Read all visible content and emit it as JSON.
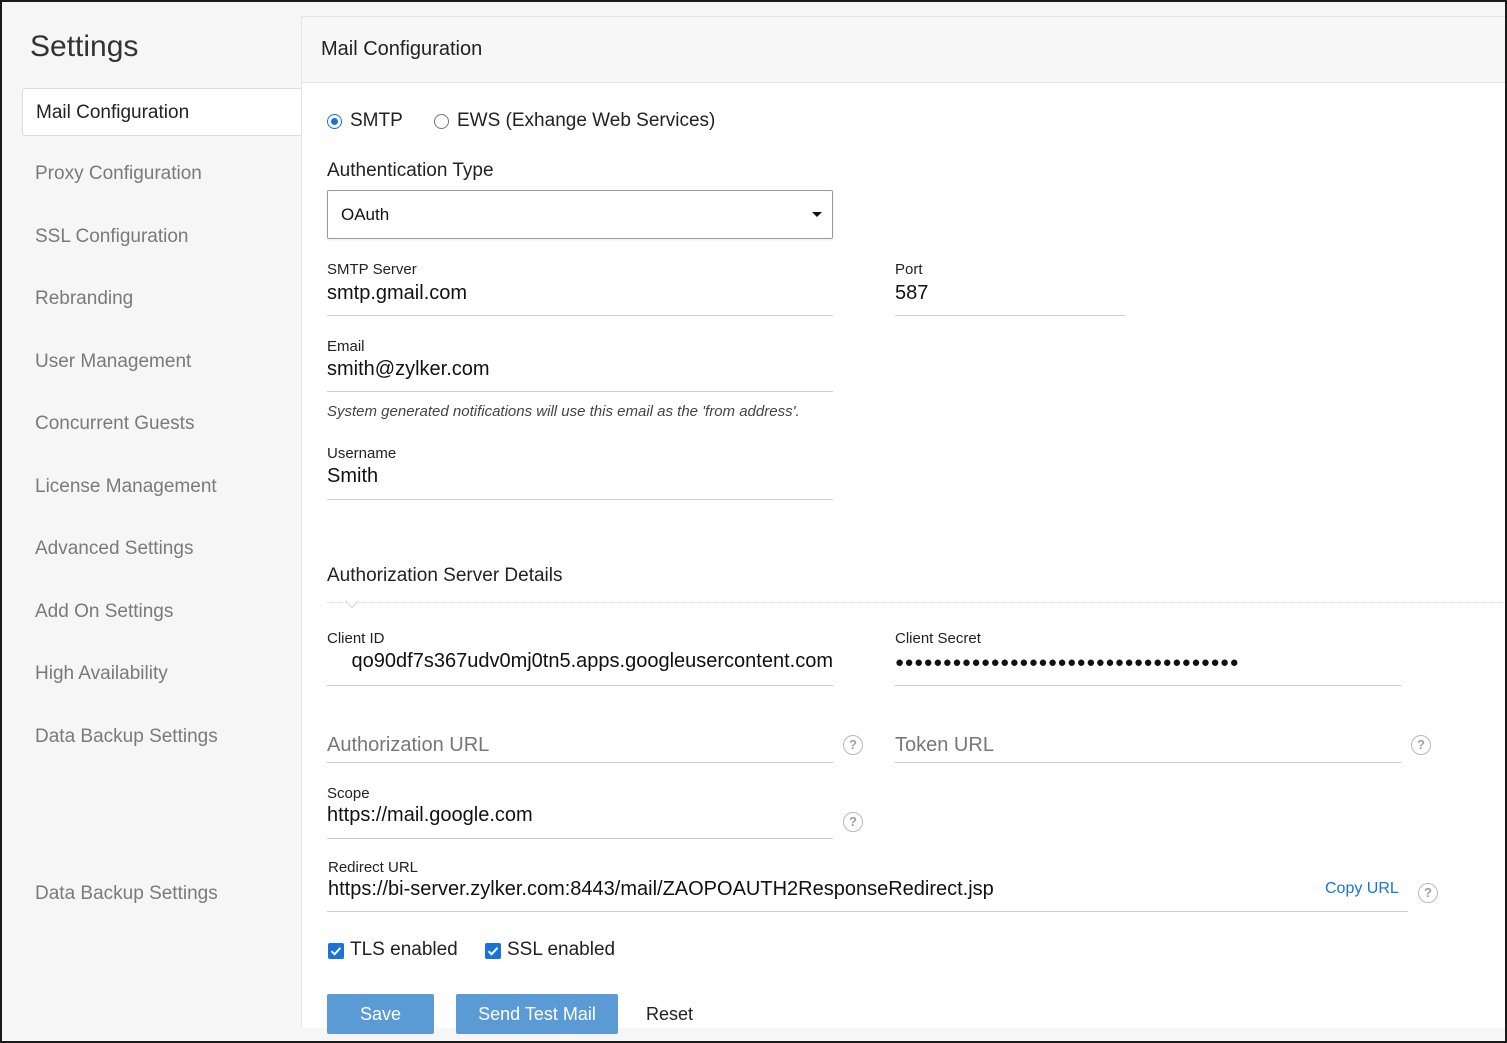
{
  "sidebar": {
    "title": "Settings",
    "items": [
      {
        "label": "Mail Configuration",
        "active": true
      },
      {
        "label": "Proxy Configuration"
      },
      {
        "label": "SSL Configuration"
      },
      {
        "label": "Rebranding"
      },
      {
        "label": "User Management"
      },
      {
        "label": "Concurrent Guests"
      },
      {
        "label": "License Management"
      },
      {
        "label": "Advanced Settings"
      },
      {
        "label": "Add On Settings"
      },
      {
        "label": "High Availability"
      },
      {
        "label": "Data Backup Settings"
      },
      {
        "label": "Data Backup Settings"
      }
    ]
  },
  "main": {
    "title": "Mail Configuration",
    "protocol": {
      "smtp_label": "SMTP",
      "ews_label": "EWS (Exhange Web Services)",
      "selected": "SMTP"
    },
    "auth_type": {
      "label": "Authentication Type",
      "value": "OAuth"
    },
    "smtp_server": {
      "label": "SMTP Server",
      "value": "smtp.gmail.com"
    },
    "port": {
      "label": "Port",
      "value": "587"
    },
    "email": {
      "label": "Email",
      "value": "smith@zylker.com",
      "hint": "System generated notifications will use this email as the 'from address'."
    },
    "username": {
      "label": "Username",
      "value": "Smith"
    },
    "auth_server": {
      "heading": "Authorization Server Details",
      "client_id": {
        "label": "Client ID",
        "value": "qo90df7s367udv0mj0tn5.apps.googleusercontent.com"
      },
      "client_secret": {
        "label": "Client Secret",
        "value": "●●●●●●●●●●●●●●●●●●●●●●●●●●●●●●●●●●●●"
      },
      "authorization_url": {
        "placeholder": "Authorization URL",
        "help": "?"
      },
      "token_url": {
        "placeholder": "Token URL",
        "help": "?"
      },
      "scope": {
        "label": "Scope",
        "value": "https://mail.google.com",
        "help": "?"
      },
      "redirect_url": {
        "label": "Redirect URL",
        "value": "https://bi-server.zylker.com:8443/mail/ZAOPOAUTH2ResponseRedirect.jsp",
        "copy_label": "Copy URL",
        "help": "?"
      }
    },
    "tls": {
      "label": "TLS enabled",
      "checked": true
    },
    "ssl": {
      "label": "SSL enabled",
      "checked": true
    },
    "buttons": {
      "save": "Save",
      "send_test": "Send Test Mail",
      "reset": "Reset"
    }
  },
  "colors": {
    "accent": "#1a73d9",
    "button": "#5b9bd5",
    "sidebar_bg": "#f6f6f6"
  }
}
